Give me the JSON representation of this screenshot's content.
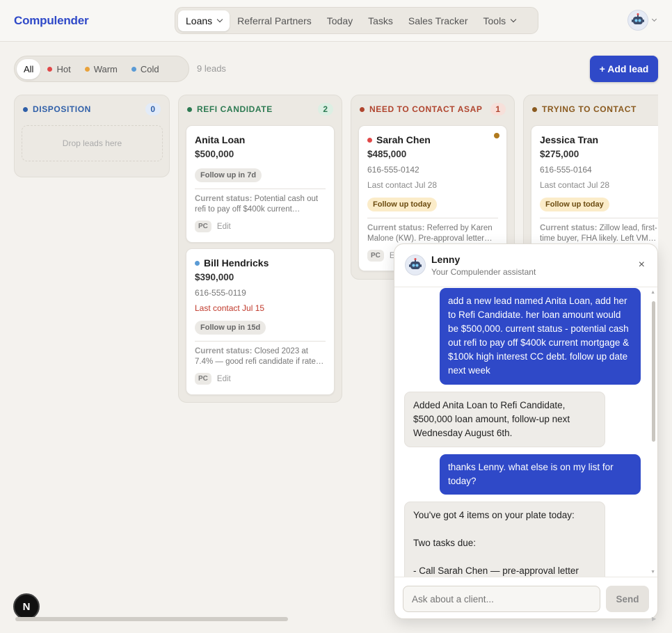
{
  "app": {
    "brand": "Compulender"
  },
  "nav": {
    "items": [
      {
        "label": "Loans",
        "active": true,
        "dropdown": true
      },
      {
        "label": "Referral Partners"
      },
      {
        "label": "Today"
      },
      {
        "label": "Tasks"
      },
      {
        "label": "Sales Tracker"
      },
      {
        "label": "Tools",
        "dropdown": true
      }
    ]
  },
  "filters": {
    "items": [
      {
        "label": "All",
        "active": true
      },
      {
        "label": "Hot",
        "color": "#e04848"
      },
      {
        "label": "Warm",
        "color": "#e9a23b"
      },
      {
        "label": "Cold",
        "color": "#5b9bd5"
      }
    ],
    "count_label": "9 leads"
  },
  "add_lead_label": "+ Add lead",
  "columns": [
    {
      "title": "DISPOSITION",
      "count": "0",
      "color": "#2f5fa8",
      "count_bg": "#e2ebf8",
      "dropzone": "Drop leads here",
      "cards": []
    },
    {
      "title": "REFI CANDIDATE",
      "count": "2",
      "color": "#2d7a52",
      "count_bg": "#dcefe3",
      "cards": [
        {
          "name": "Anita Loan",
          "amount": "$500,000",
          "follow": "Follow up in 7d",
          "follow_style": "grey",
          "status_label": "Current status:",
          "status": "Potential cash out refi to pay off $400k current…",
          "badge": "PC",
          "edit": "Edit"
        },
        {
          "name": "Bill Hendricks",
          "dot": "#5b9bd5",
          "amount": "$390,000",
          "phone": "616-555-0119",
          "last": "Last contact Jul 15",
          "last_late": true,
          "follow": "Follow up in 15d",
          "follow_style": "grey",
          "status_label": "Current status:",
          "status": "Closed 2023 at 7.4% — good refi candidate if rate…",
          "badge": "PC",
          "edit": "Edit"
        }
      ]
    },
    {
      "title": "NEED TO CONTACT ASAP",
      "count": "1",
      "color": "#b0452f",
      "count_bg": "#f7e0da",
      "cards": [
        {
          "name": "Sarah Chen",
          "dot": "#e04848",
          "heat": "#b07a1e",
          "amount": "$485,000",
          "phone": "616-555-0142",
          "last": "Last contact Jul 28",
          "follow": "Follow up today",
          "follow_style": "yellow",
          "status_label": "Current status:",
          "status": "Referred by Karen Malone (KW). Pre-approval letter…",
          "badge": "PC",
          "edit": "Edit"
        }
      ]
    },
    {
      "title": "TRYING TO CONTACT",
      "color": "#8a5a1f",
      "count_bg": "#f3e7d5",
      "cards": [
        {
          "name": "Jessica Tran",
          "amount": "$275,000",
          "phone": "616-555-0164",
          "last": "Last contact Jul 28",
          "follow": "Follow up today",
          "follow_style": "yellow",
          "status_label": "Current status:",
          "status": "Zillow lead, first-time buyer, FHA likely. Left VM…"
        }
      ]
    }
  ],
  "chat": {
    "title": "Lenny",
    "subtitle": "Your Compulender assistant",
    "close": "×",
    "messages": [
      {
        "role": "user",
        "text": "add a new lead named Anita Loan, add her to Refi Candidate. her loan amount would be $500,000. current status - potential cash out refi to pay off $400k current mortgage & $100k high interest CC debt. follow up date next week"
      },
      {
        "role": "bot",
        "text": "Added Anita Loan to Refi Candidate, $500,000 loan amount, follow-up next Wednesday August 6th."
      },
      {
        "role": "user",
        "text": "thanks Lenny. what else is on my list for today?"
      },
      {
        "role": "bot",
        "text": "You've got 4 items on your plate today:\n\nTwo tasks due:\n\n- Call Sarah Chen — pre-approval letter"
      }
    ],
    "input_placeholder": "Ask about a client...",
    "send_label": "Send"
  },
  "dev_badge": "N"
}
